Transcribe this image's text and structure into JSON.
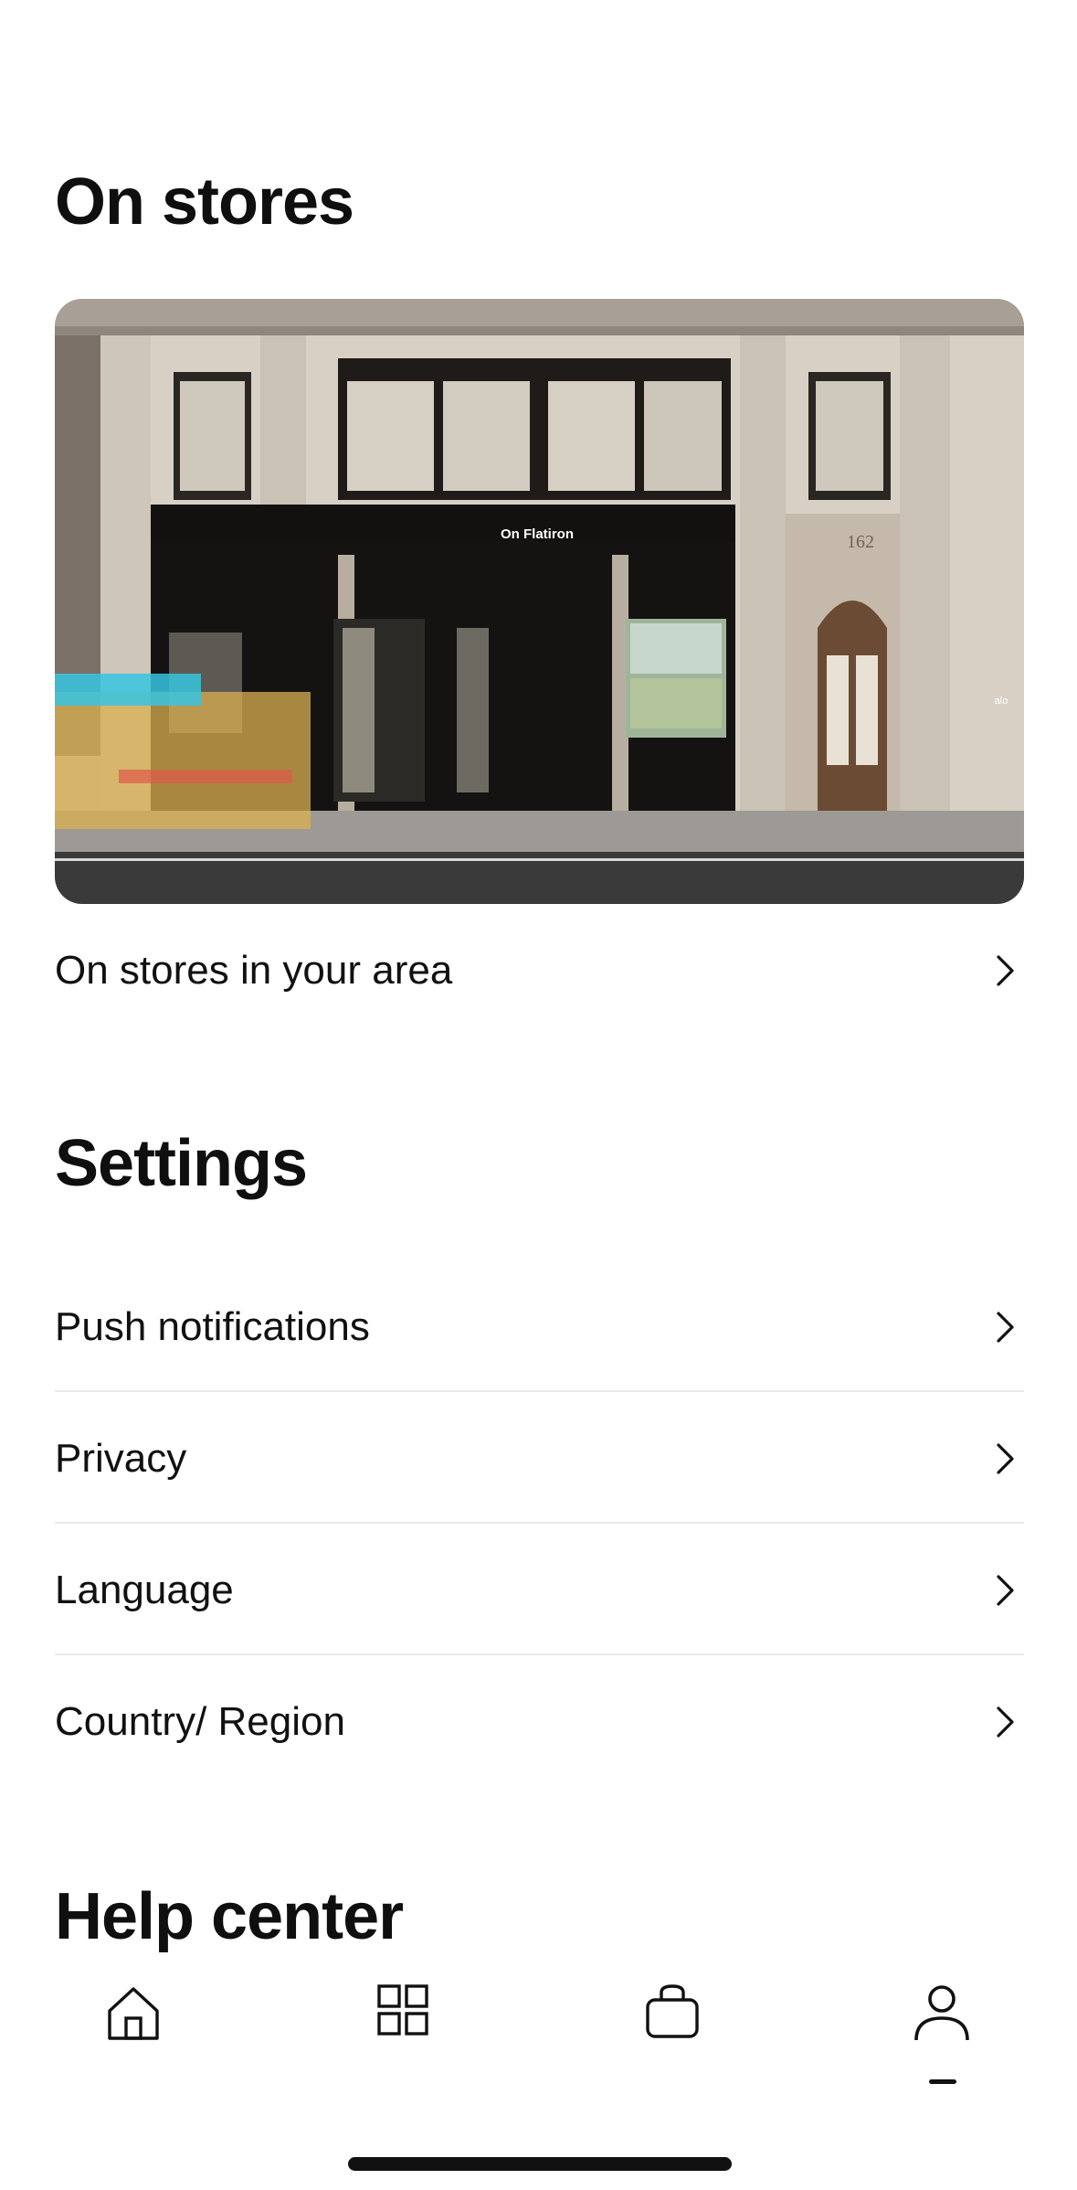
{
  "stores": {
    "title": "On stores",
    "image_sign": "On Flatiron",
    "image_building_number": "162",
    "image_neighbor_sign": "alo",
    "link_label": "On stores in your area"
  },
  "settings": {
    "title": "Settings",
    "items": [
      {
        "label": "Push notifications"
      },
      {
        "label": "Privacy"
      },
      {
        "label": "Language"
      },
      {
        "label": "Country/ Region"
      }
    ]
  },
  "help": {
    "title": "Help center"
  },
  "tabbar": {
    "tabs": [
      {
        "icon": "home-icon",
        "active": false
      },
      {
        "icon": "grid-icon",
        "active": false
      },
      {
        "icon": "bag-icon",
        "active": false
      },
      {
        "icon": "profile-icon",
        "active": true
      }
    ]
  },
  "colors": {
    "text": "#111111",
    "divider": "#e9e9e9",
    "background": "#ffffff"
  }
}
